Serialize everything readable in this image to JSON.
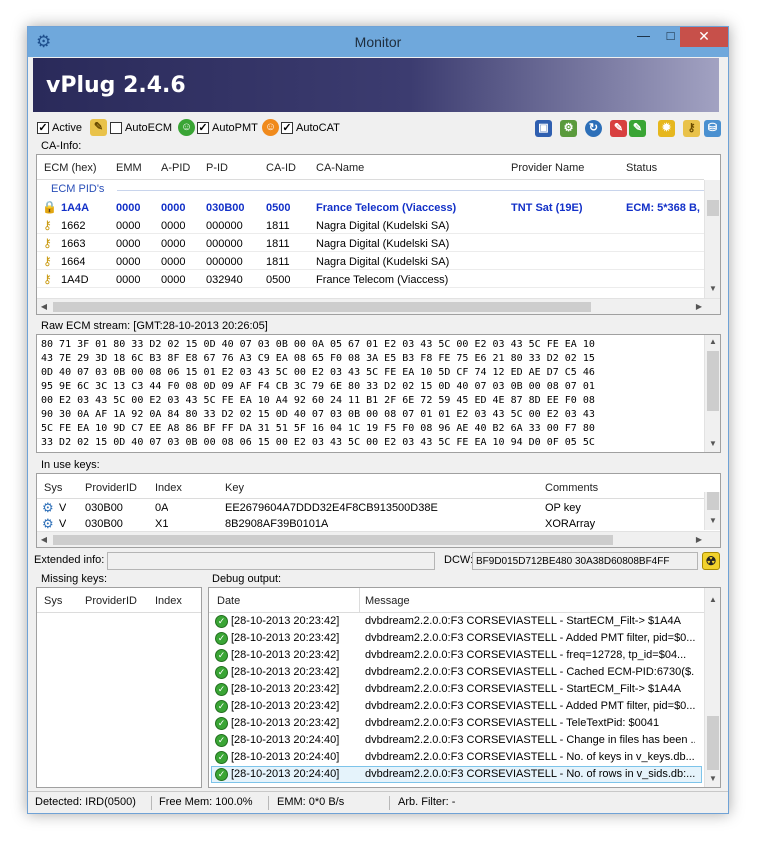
{
  "window": {
    "title": "Monitor",
    "minimize": "—",
    "maximize": "□",
    "close": "✕"
  },
  "banner": {
    "title": "vPlug 2.4.6"
  },
  "toolbar": {
    "active_label": "Active",
    "active_checked": true,
    "autoecm_label": "AutoECM",
    "autoecm_checked": false,
    "autopmt_label": "AutoPMT",
    "autopmt_checked": true,
    "autocat_label": "AutoCAT",
    "autocat_checked": true,
    "icons": [
      "save-icon",
      "settings-icon",
      "refresh-icon",
      "pen-red-icon",
      "pen-green-icon",
      "gear-yellow-icon",
      "key-icon",
      "database-icon"
    ]
  },
  "ca_info": {
    "label": "CA-Info:",
    "columns": [
      "ECM (hex)",
      "EMM",
      "A-PID",
      "P-ID",
      "CA-ID",
      "CA-Name",
      "Provider Name",
      "Status"
    ],
    "group": "ECM PID's",
    "rows": [
      {
        "ecm": "1A4A",
        "emm": "0000",
        "apid": "0000",
        "pid": "030B00",
        "caid": "0500",
        "caname": "France Telecom (Viaccess)",
        "provider": "TNT Sat (19E)",
        "status": "ECM: 5*368 B,",
        "active": true
      },
      {
        "ecm": "1662",
        "emm": "0000",
        "apid": "0000",
        "pid": "000000",
        "caid": "1811",
        "caname": "Nagra Digital (Kudelski SA)",
        "provider": "",
        "status": "",
        "active": false
      },
      {
        "ecm": "1663",
        "emm": "0000",
        "apid": "0000",
        "pid": "000000",
        "caid": "1811",
        "caname": "Nagra Digital (Kudelski SA)",
        "provider": "",
        "status": "",
        "active": false
      },
      {
        "ecm": "1664",
        "emm": "0000",
        "apid": "0000",
        "pid": "000000",
        "caid": "1811",
        "caname": "Nagra Digital (Kudelski SA)",
        "provider": "",
        "status": "",
        "active": false
      },
      {
        "ecm": "1A4D",
        "emm": "0000",
        "apid": "0000",
        "pid": "032940",
        "caid": "0500",
        "caname": "France Telecom (Viaccess)",
        "provider": "",
        "status": "",
        "active": false
      }
    ]
  },
  "raw_ecm": {
    "label": "Raw ECM stream: [GMT:28-10-2013 20:26:05]",
    "lines": [
      "80 71 3F 01 80 33 D2 02 15 0D 40 07 03 0B 00 0A 05 67 01 E2 03 43 5C 00 E2 03 43 5C FE EA 10",
      "43 7E 29 3D 18 6C B3 8F E8 67 76 A3 C9 EA 08 65 F0 08 3A E5 B3 F8 FE 75 E6 21 80 33 D2 02 15",
      "0D 40 07 03 0B 00 08 06 15 01 E2 03 43 5C 00 E2 03 43 5C FE EA 10 5D CF 74 12 ED AE D7 C5 46",
      "95 9E 6C 3C 13 C3 44 F0 08 0D 09 AF F4 CB 3C 79 6E 80 33 D2 02 15 0D 40 07 03 0B 00 08 07 01",
      "00 E2 03 43 5C 00 E2 03 43 5C FE EA 10 A4 92 60 24 11 B1 2F 6E 72 59 45 ED 4E 87 8D EE F0 08",
      "90 30 0A AF 1A 92 0A 84 80 33 D2 02 15 0D 40 07 03 0B 00 08 07 01 01 E2 03 43 5C 00 E2 03 43",
      "5C FE EA 10 9D C7 EE A8 86 BF FF DA 31 51 5F 16 04 1C 19 F5 F0 08 96 AE 40 B2 6A 33 00 F7 80",
      "33 D2 02 15 0D 40 07 03 0B 00 08 06 15 00 E2 03 43 5C 00 E2 03 43 5C FE EA 10 94 D0 0F 05 5C"
    ]
  },
  "in_use_keys": {
    "label": "In use keys:",
    "columns": [
      "Sys",
      "ProviderID",
      "Index",
      "Key",
      "Comments"
    ],
    "rows": [
      {
        "sys": "V",
        "provider": "030B00",
        "index": "0A",
        "key": "EE2679604A7DDD32E4F8CB913500D38E",
        "comment": "OP key"
      },
      {
        "sys": "V",
        "provider": "030B00",
        "index": "X1",
        "key": "8B2908AF39B0101A",
        "comment": "XORArray"
      }
    ]
  },
  "extended": {
    "label": "Extended info:",
    "value": "",
    "dcw_label": "DCW:",
    "dcw_value": "BF9D015D712BE480 30A38D60808BF4FF"
  },
  "missing_keys": {
    "label": "Missing keys:",
    "columns": [
      "Sys",
      "ProviderID",
      "Index"
    ]
  },
  "debug": {
    "label": "Debug output:",
    "columns": [
      "Date",
      "Message"
    ],
    "rows": [
      {
        "date": "[28-10-2013 20:23:42]",
        "message": "dvbdream2.2.0.0:F3 CORSEVIASTELL - StartECM_Filt-> $1A4A"
      },
      {
        "date": "[28-10-2013 20:23:42]",
        "message": "dvbdream2.2.0.0:F3 CORSEVIASTELL - Added PMT filter, pid=$0..."
      },
      {
        "date": "[28-10-2013 20:23:42]",
        "message": "dvbdream2.2.0.0:F3 CORSEVIASTELL - freq=12728, tp_id=$04..."
      },
      {
        "date": "[28-10-2013 20:23:42]",
        "message": "dvbdream2.2.0.0:F3 CORSEVIASTELL - Cached ECM-PID:6730($..."
      },
      {
        "date": "[28-10-2013 20:23:42]",
        "message": "dvbdream2.2.0.0:F3 CORSEVIASTELL - StartECM_Filt-> $1A4A"
      },
      {
        "date": "[28-10-2013 20:23:42]",
        "message": "dvbdream2.2.0.0:F3 CORSEVIASTELL - Added PMT filter, pid=$0..."
      },
      {
        "date": "[28-10-2013 20:23:42]",
        "message": "dvbdream2.2.0.0:F3 CORSEVIASTELL - TeleTextPid: $0041"
      },
      {
        "date": "[28-10-2013 20:24:40]",
        "message": "dvbdream2.2.0.0:F3 CORSEVIASTELL - Change in files has been ..."
      },
      {
        "date": "[28-10-2013 20:24:40]",
        "message": "dvbdream2.2.0.0:F3 CORSEVIASTELL - No. of keys in v_keys.db..."
      },
      {
        "date": "[28-10-2013 20:24:40]",
        "message": "dvbdream2.2.0.0:F3 CORSEVIASTELL - No. of rows in v_sids.db:..."
      }
    ]
  },
  "status": {
    "detected": "Detected: IRD(0500)",
    "memory": "Free Mem: 100.0%",
    "emm": "EMM: 0*0 B/s",
    "filter": "Arb. Filter: -"
  }
}
